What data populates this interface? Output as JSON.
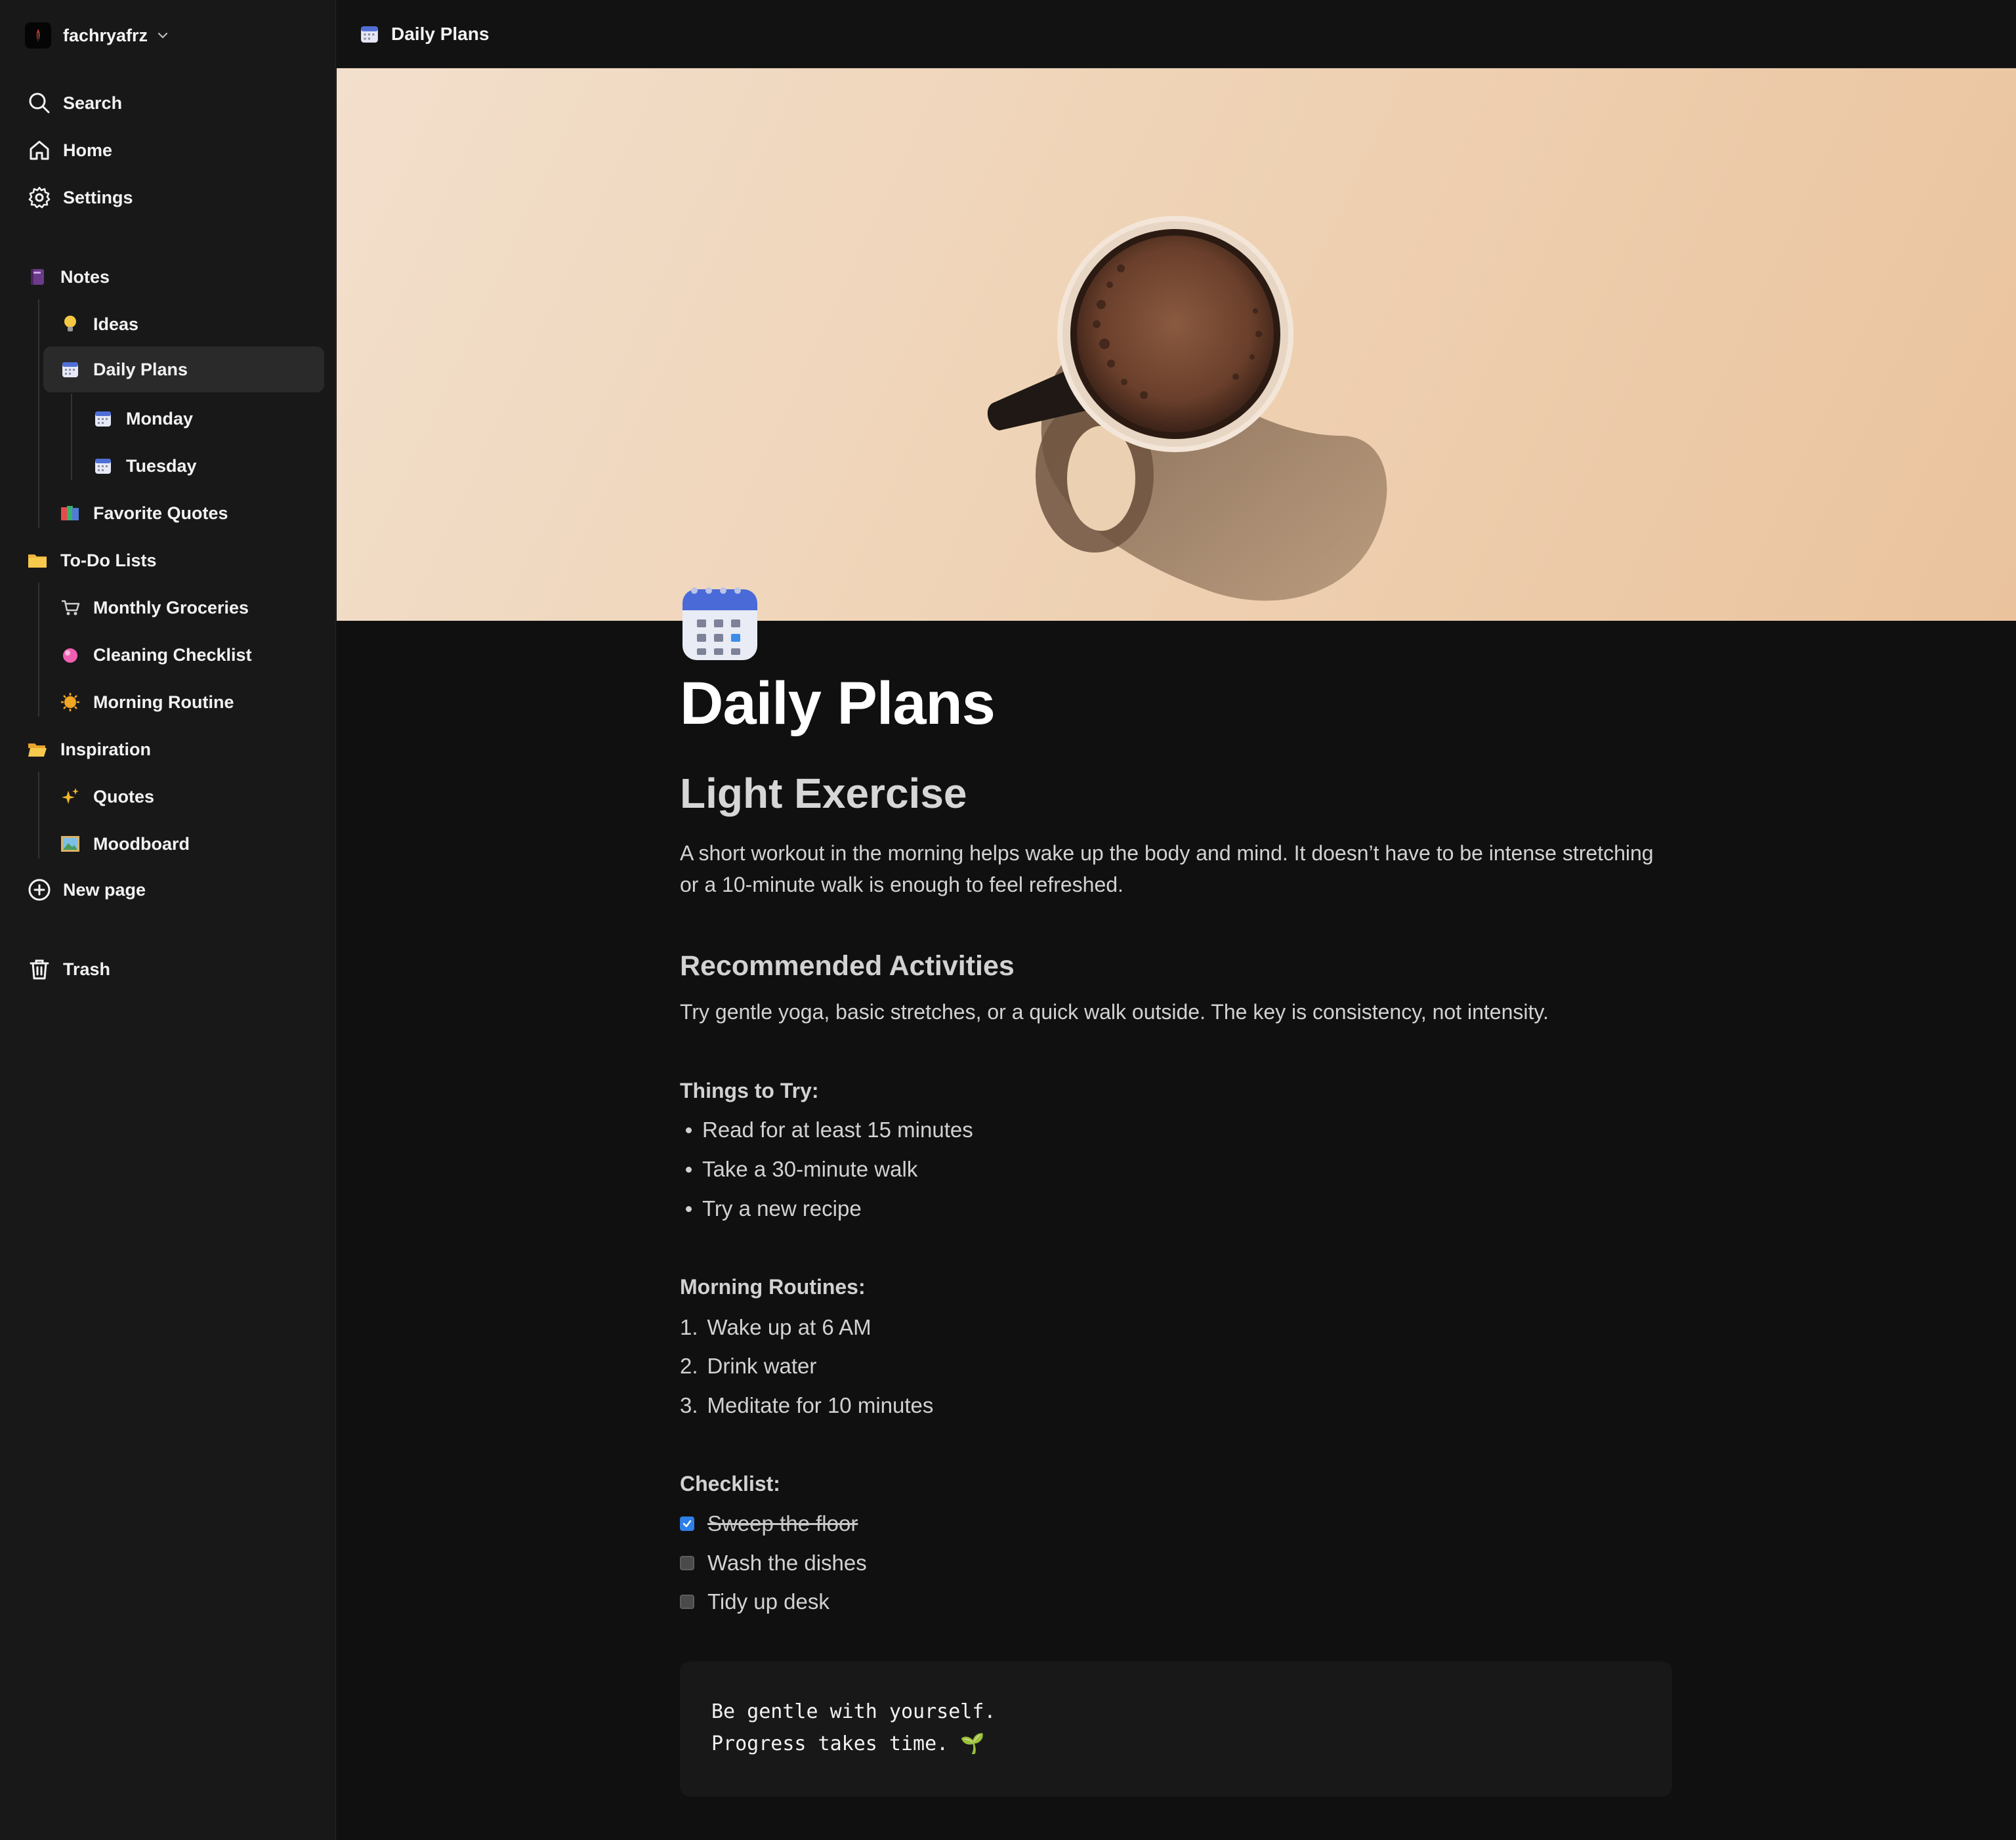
{
  "workspace": {
    "name": "fachryafrz"
  },
  "nav": {
    "search": "Search",
    "home": "Home",
    "settings": "Settings",
    "new_page": "New page",
    "trash": "Trash"
  },
  "tree": {
    "notes": "Notes",
    "ideas": "Ideas",
    "daily_plans": "Daily Plans",
    "monday": "Monday",
    "tuesday": "Tuesday",
    "favorite_quotes": "Favorite Quotes",
    "todo_lists": "To-Do Lists",
    "monthly_groceries": "Monthly Groceries",
    "cleaning_checklist": "Cleaning Checklist",
    "morning_routine": "Morning Routine",
    "inspiration": "Inspiration",
    "quotes": "Quotes",
    "moodboard": "Moodboard"
  },
  "topbar": {
    "title": "Daily Plans"
  },
  "page": {
    "title": "Daily Plans",
    "heading": "Light Exercise",
    "intro": "A short workout in the morning helps wake up the body and mind. It doesn’t have to be intense stretching or a 10-minute walk is enough to feel refreshed.",
    "subheading": "Recommended Activities",
    "activities_text": "Try gentle yoga, basic stretches, or a quick walk outside. The key is consistency, not intensity.",
    "things_label": "Things to Try:",
    "things": [
      "Read for at least 15 minutes",
      "Take a 30-minute walk",
      "Try a new recipe"
    ],
    "routines_label": "Morning Routines:",
    "routines": [
      "Wake up at 6 AM",
      "Drink water",
      "Meditate for 10 minutes"
    ],
    "routine_numbers": [
      "1.",
      "2.",
      "3."
    ],
    "checklist_label": "Checklist:",
    "checklist": [
      {
        "text": "Sweep the floor",
        "checked": true
      },
      {
        "text": "Wash the dishes",
        "checked": false
      },
      {
        "text": "Tidy up desk",
        "checked": false
      }
    ],
    "code_lines": [
      "Be gentle with yourself.",
      "Progress takes time. 🌱"
    ]
  },
  "colors": {
    "accent": "#2f7fe8",
    "background": "#101010",
    "sidebar": "#181818"
  }
}
